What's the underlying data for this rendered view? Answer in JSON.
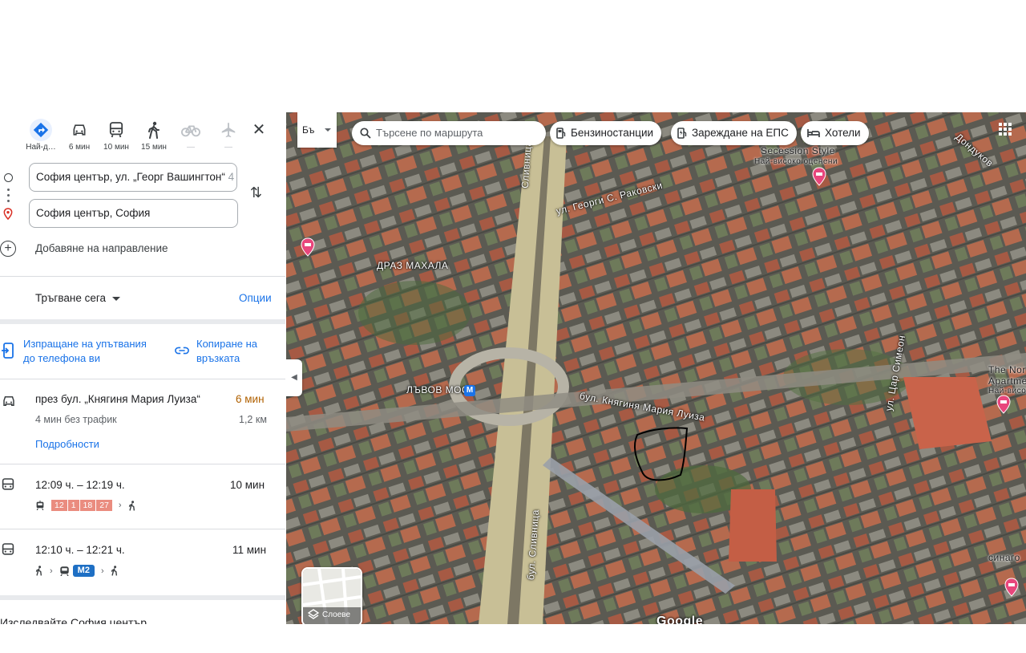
{
  "travel_modes": [
    {
      "name": "best",
      "label": "Най-д…",
      "active": true
    },
    {
      "name": "car",
      "label": "6 мин"
    },
    {
      "name": "transit",
      "label": "10 мин"
    },
    {
      "name": "walk",
      "label": "15 мин"
    },
    {
      "name": "bike",
      "label": "—",
      "dim": true
    },
    {
      "name": "flight",
      "label": "—",
      "dim": true
    }
  ],
  "origin": {
    "value": "София център, ул. „Георг Вашингтон“",
    "overflow": " 4"
  },
  "destination": {
    "value": "София център, София"
  },
  "add_destination_label": "Добавяне на направление",
  "departure": {
    "label": "Тръгване сега",
    "options_label": "Опции"
  },
  "share": {
    "send_line1": "Изпращане на упътвания",
    "send_line2": "до телефона ви",
    "copy_line1": "Копиране на",
    "copy_line2": "връзката"
  },
  "driving_route": {
    "via": "през бул. „Княгиня Мария Луиза“",
    "duration": "6 мин",
    "no_traffic": "4 мин без трафик",
    "distance": "1,2 км",
    "details_label": "Подробности"
  },
  "transit_routes": [
    {
      "time": "12:09 ч. – 12:19 ч.",
      "duration": "10 мин",
      "lines": [
        "12",
        "1",
        "18",
        "27"
      ]
    },
    {
      "time": "12:10 ч. – 12:21 ч.",
      "duration": "11 мин",
      "metro": "M2"
    }
  ],
  "explore_label": "Изследвайте София център",
  "map": {
    "lang_label": "Бъ",
    "search_placeholder": "Търсене по маршрута",
    "chips": {
      "gas": "Бензиностанции",
      "ev": "Зареждане на ЕПС",
      "hotels": "Хотели"
    },
    "layers_label": "Слоеве",
    "labels": {
      "district": "ДРАЗ МАХАЛА",
      "metro": "ЛЪВОВ МОСТ",
      "street1": "ул. Георги С. Раковски",
      "street2": "бул. Княгиня Мария Луиза",
      "street3": "ул. Цар Симеон",
      "street4": "бул. Сливница",
      "street5": "Сливница",
      "street6": "Дондуков",
      "hotel1": "Secession Style",
      "hotel1_sub": "Най-високо оценени",
      "hotel2": "The Nor",
      "hotel2_sub": "Apartme",
      "hotel2_sub2": "Най-високо",
      "poi": "синаго",
      "watermark": "Google"
    }
  }
}
